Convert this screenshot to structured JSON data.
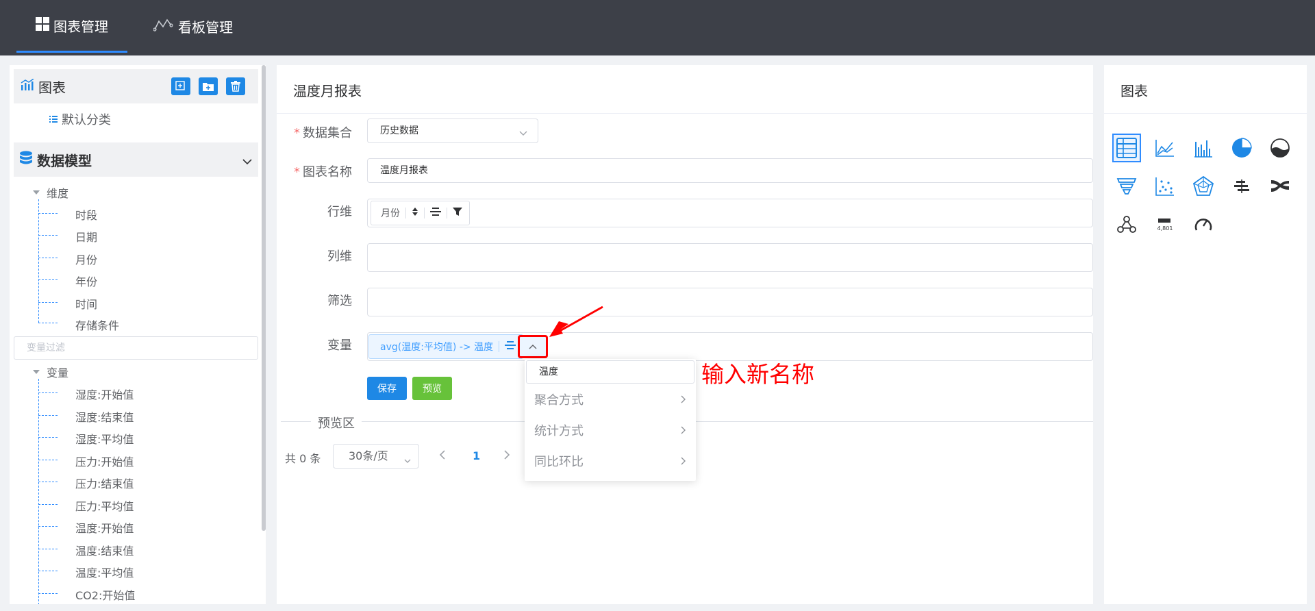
{
  "topnav": {
    "chart_manage": "图表管理",
    "board_manage": "看板管理"
  },
  "left": {
    "chart_section_title": "图表",
    "default_category": "默认分类",
    "data_model_title": "数据模型",
    "dimension_group": "维度",
    "dimensions": [
      "时段",
      "日期",
      "月份",
      "年份",
      "时间",
      "存储条件"
    ],
    "variable_filter_placeholder": "变量过滤",
    "variable_group": "变量",
    "variables": [
      "湿度:开始值",
      "湿度:结束值",
      "湿度:平均值",
      "压力:开始值",
      "压力:结束值",
      "压力:平均值",
      "温度:开始值",
      "温度:结束值",
      "温度:平均值",
      "CO2:开始值"
    ]
  },
  "center": {
    "title": "温度月报表",
    "dataset_label": "数据集合",
    "dataset_value": "历史数据",
    "chart_name_label": "图表名称",
    "chart_name_value": "温度月报表",
    "row_dim_label": "行维",
    "row_dim_pill": "月份",
    "col_dim_label": "列维",
    "filter_label": "筛选",
    "variable_label": "变量",
    "variable_pill": "avg(温度:平均值) -> 温度",
    "save_button": "保存",
    "preview_button": "预览",
    "preview_area": "预览区",
    "pager_total": "共 0 条",
    "pager_size": "30条/页",
    "pager_current": "1"
  },
  "dropdown": {
    "rename_value": "温度",
    "items": [
      "聚合方式",
      "统计方式",
      "同比环比"
    ]
  },
  "annotation": "输入新名称",
  "right": {
    "title": "图表",
    "chart_types": [
      "table-icon",
      "line-chart-icon",
      "bar-chart-icon",
      "pie-chart-icon",
      "liquid-fill-icon",
      "funnel-icon",
      "scatter-icon",
      "radar-icon",
      "bidirectional-bar-icon",
      "sankey-icon",
      "graph-icon",
      "number-card-icon",
      "gauge-icon"
    ],
    "number_card_text": "4,801"
  },
  "colors": {
    "accent": "#1e88e5",
    "success": "#67c23a",
    "annotation": "#ff0000",
    "topbar": "#3d4048"
  }
}
